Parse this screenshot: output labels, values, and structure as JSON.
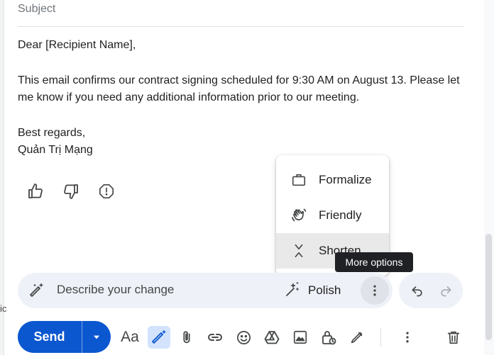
{
  "compose": {
    "subject_placeholder": "Subject",
    "body": {
      "greeting": "Dear [Recipient Name],",
      "paragraph": "This email confirms our contract signing scheduled for 9:30 AM on August 13. Please let me know if you need any additional information prior to our meeting.",
      "closing": "Best regards,",
      "signature": "Quản Trị Mạng"
    }
  },
  "feedback": {
    "icons": [
      "thumbs-up-icon",
      "thumbs-down-icon",
      "report-icon"
    ]
  },
  "menu": {
    "items": [
      {
        "label": "Formalize",
        "icon": "briefcase-icon"
      },
      {
        "label": "Friendly",
        "icon": "waving-hand-icon"
      },
      {
        "label": "Shorten",
        "icon": "collapse-icon"
      }
    ]
  },
  "tooltip": {
    "text": "More options"
  },
  "refine": {
    "placeholder": "Describe your change",
    "polish_label": "Polish"
  },
  "toolbar": {
    "send_label": "Send",
    "formatting_label": "Aa"
  },
  "left_fragment": "ic",
  "colors": {
    "send": "#0b57d0",
    "refine_bg": "#eef1f7",
    "tooltip_bg": "#202124",
    "selected_tool": "#d3e3fd"
  }
}
